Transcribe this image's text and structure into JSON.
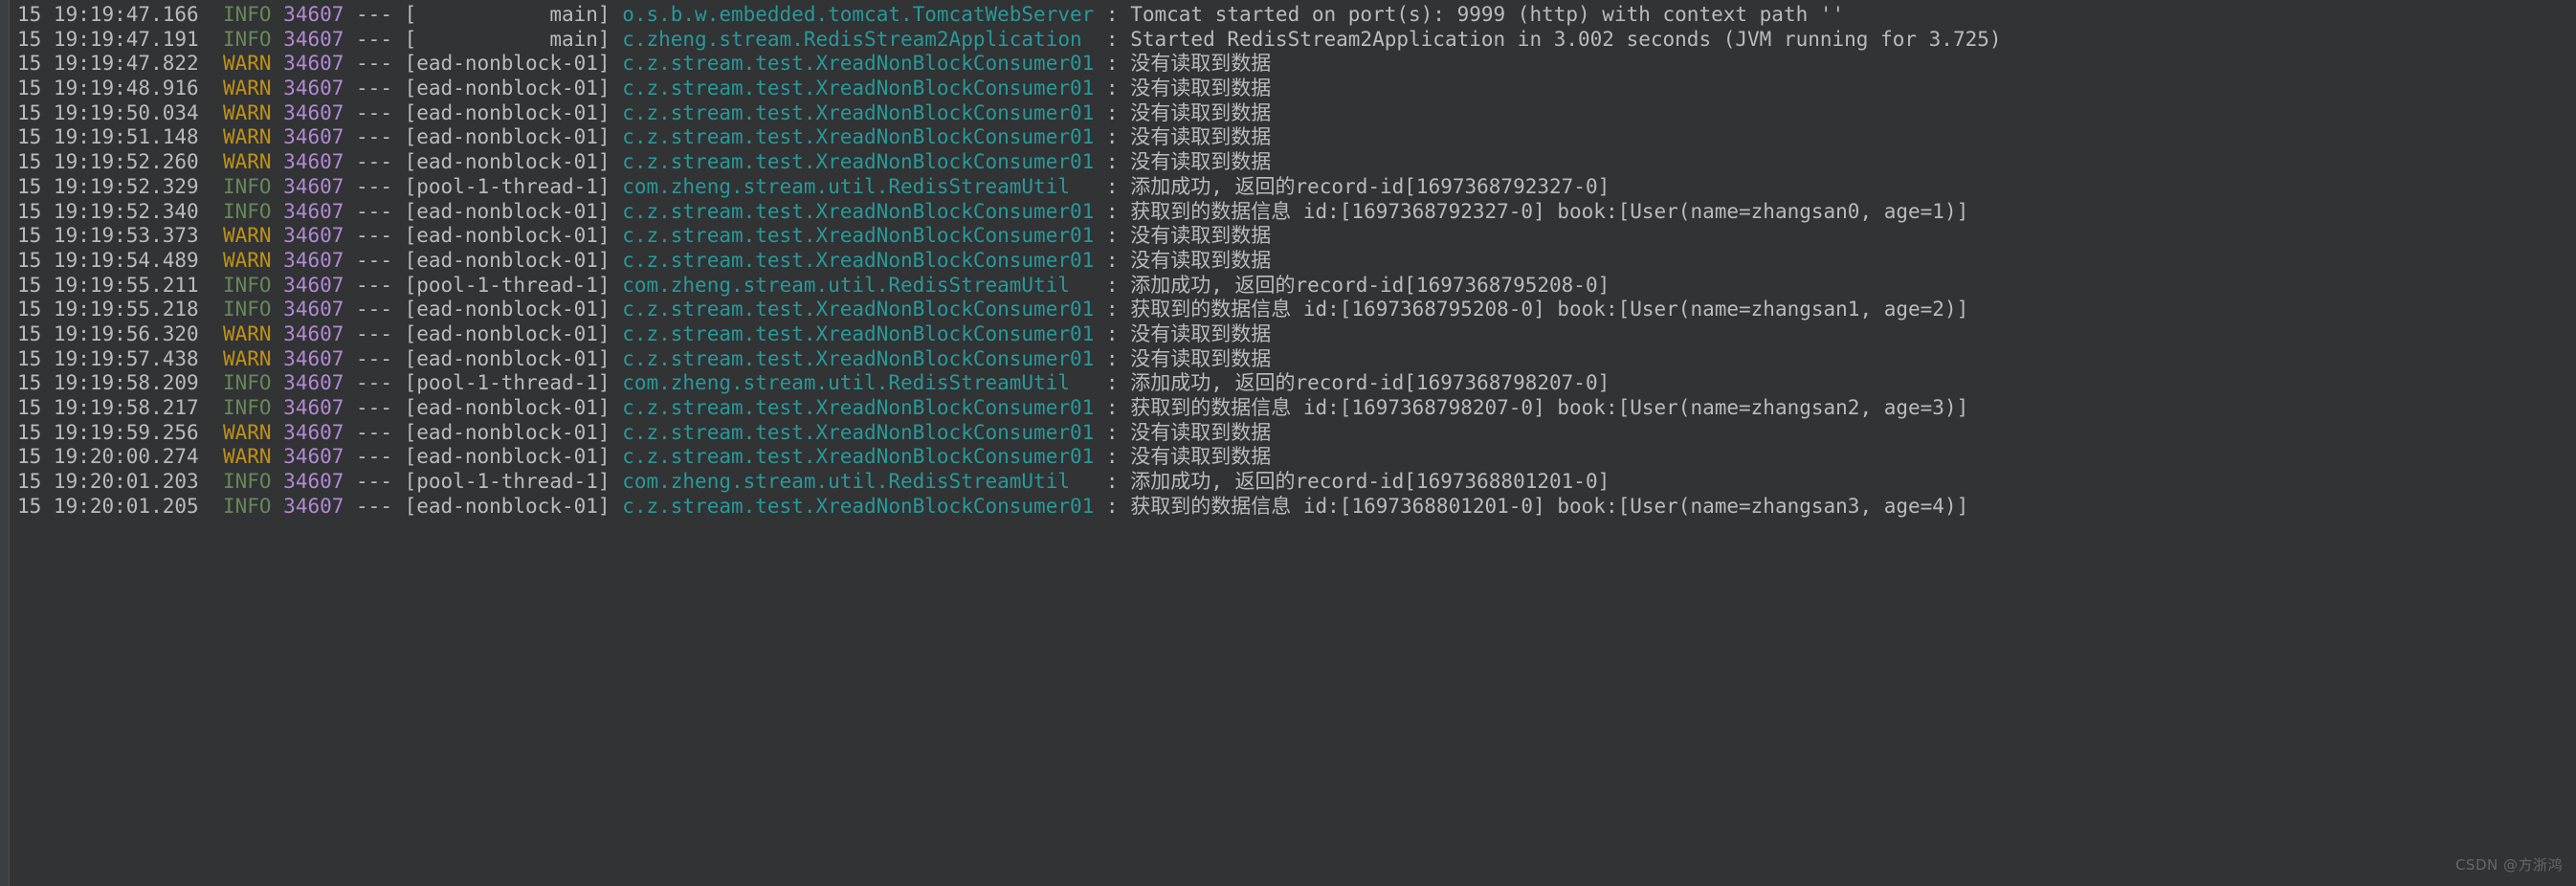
{
  "console": {
    "name": "spring-boot-console-log",
    "background_color": "#313335",
    "colors": {
      "plain": "#bbbbbb",
      "info": "#6a8759",
      "warn": "#bf9117",
      "pid": "#b389d4",
      "logger": "#299999",
      "message": "#bbbbbb"
    },
    "watermark": "CSDN @方浙鸿",
    "pid": "34607",
    "day": "15",
    "lines": [
      {
        "day": "15",
        "time": "19:19:47.166",
        "level": "INFO",
        "pid": "34607",
        "dashes": "---",
        "thread": "[           main]",
        "logger": "o.s.b.w.embedded.tomcat.TomcatWebServer",
        "sep": ":",
        "message": "Tomcat started on port(s): 9999 (http) with context path ''"
      },
      {
        "day": "15",
        "time": "19:19:47.191",
        "level": "INFO",
        "pid": "34607",
        "dashes": "---",
        "thread": "[           main]",
        "logger": "c.zheng.stream.RedisStream2Application",
        "sep": ":",
        "message": "Started RedisStream2Application in 3.002 seconds (JVM running for 3.725)"
      },
      {
        "day": "15",
        "time": "19:19:47.822",
        "level": "WARN",
        "pid": "34607",
        "dashes": "---",
        "thread": "[ead-nonblock-01]",
        "logger": "c.z.stream.test.XreadNonBlockConsumer01",
        "sep": ":",
        "message": "没有读取到数据"
      },
      {
        "day": "15",
        "time": "19:19:48.916",
        "level": "WARN",
        "pid": "34607",
        "dashes": "---",
        "thread": "[ead-nonblock-01]",
        "logger": "c.z.stream.test.XreadNonBlockConsumer01",
        "sep": ":",
        "message": "没有读取到数据"
      },
      {
        "day": "15",
        "time": "19:19:50.034",
        "level": "WARN",
        "pid": "34607",
        "dashes": "---",
        "thread": "[ead-nonblock-01]",
        "logger": "c.z.stream.test.XreadNonBlockConsumer01",
        "sep": ":",
        "message": "没有读取到数据"
      },
      {
        "day": "15",
        "time": "19:19:51.148",
        "level": "WARN",
        "pid": "34607",
        "dashes": "---",
        "thread": "[ead-nonblock-01]",
        "logger": "c.z.stream.test.XreadNonBlockConsumer01",
        "sep": ":",
        "message": "没有读取到数据"
      },
      {
        "day": "15",
        "time": "19:19:52.260",
        "level": "WARN",
        "pid": "34607",
        "dashes": "---",
        "thread": "[ead-nonblock-01]",
        "logger": "c.z.stream.test.XreadNonBlockConsumer01",
        "sep": ":",
        "message": "没有读取到数据"
      },
      {
        "day": "15",
        "time": "19:19:52.329",
        "level": "INFO",
        "pid": "34607",
        "dashes": "---",
        "thread": "[pool-1-thread-1]",
        "logger": "com.zheng.stream.util.RedisStreamUtil",
        "sep": ":",
        "message": "添加成功, 返回的record-id[1697368792327-0]"
      },
      {
        "day": "15",
        "time": "19:19:52.340",
        "level": "INFO",
        "pid": "34607",
        "dashes": "---",
        "thread": "[ead-nonblock-01]",
        "logger": "c.z.stream.test.XreadNonBlockConsumer01",
        "sep": ":",
        "message": "获取到的数据信息 id:[1697368792327-0] book:[User(name=zhangsan0, age=1)]"
      },
      {
        "day": "15",
        "time": "19:19:53.373",
        "level": "WARN",
        "pid": "34607",
        "dashes": "---",
        "thread": "[ead-nonblock-01]",
        "logger": "c.z.stream.test.XreadNonBlockConsumer01",
        "sep": ":",
        "message": "没有读取到数据"
      },
      {
        "day": "15",
        "time": "19:19:54.489",
        "level": "WARN",
        "pid": "34607",
        "dashes": "---",
        "thread": "[ead-nonblock-01]",
        "logger": "c.z.stream.test.XreadNonBlockConsumer01",
        "sep": ":",
        "message": "没有读取到数据"
      },
      {
        "day": "15",
        "time": "19:19:55.211",
        "level": "INFO",
        "pid": "34607",
        "dashes": "---",
        "thread": "[pool-1-thread-1]",
        "logger": "com.zheng.stream.util.RedisStreamUtil",
        "sep": ":",
        "message": "添加成功, 返回的record-id[1697368795208-0]"
      },
      {
        "day": "15",
        "time": "19:19:55.218",
        "level": "INFO",
        "pid": "34607",
        "dashes": "---",
        "thread": "[ead-nonblock-01]",
        "logger": "c.z.stream.test.XreadNonBlockConsumer01",
        "sep": ":",
        "message": "获取到的数据信息 id:[1697368795208-0] book:[User(name=zhangsan1, age=2)]"
      },
      {
        "day": "15",
        "time": "19:19:56.320",
        "level": "WARN",
        "pid": "34607",
        "dashes": "---",
        "thread": "[ead-nonblock-01]",
        "logger": "c.z.stream.test.XreadNonBlockConsumer01",
        "sep": ":",
        "message": "没有读取到数据"
      },
      {
        "day": "15",
        "time": "19:19:57.438",
        "level": "WARN",
        "pid": "34607",
        "dashes": "---",
        "thread": "[ead-nonblock-01]",
        "logger": "c.z.stream.test.XreadNonBlockConsumer01",
        "sep": ":",
        "message": "没有读取到数据"
      },
      {
        "day": "15",
        "time": "19:19:58.209",
        "level": "INFO",
        "pid": "34607",
        "dashes": "---",
        "thread": "[pool-1-thread-1]",
        "logger": "com.zheng.stream.util.RedisStreamUtil",
        "sep": ":",
        "message": "添加成功, 返回的record-id[1697368798207-0]"
      },
      {
        "day": "15",
        "time": "19:19:58.217",
        "level": "INFO",
        "pid": "34607",
        "dashes": "---",
        "thread": "[ead-nonblock-01]",
        "logger": "c.z.stream.test.XreadNonBlockConsumer01",
        "sep": ":",
        "message": "获取到的数据信息 id:[1697368798207-0] book:[User(name=zhangsan2, age=3)]"
      },
      {
        "day": "15",
        "time": "19:19:59.256",
        "level": "WARN",
        "pid": "34607",
        "dashes": "---",
        "thread": "[ead-nonblock-01]",
        "logger": "c.z.stream.test.XreadNonBlockConsumer01",
        "sep": ":",
        "message": "没有读取到数据"
      },
      {
        "day": "15",
        "time": "19:20:00.274",
        "level": "WARN",
        "pid": "34607",
        "dashes": "---",
        "thread": "[ead-nonblock-01]",
        "logger": "c.z.stream.test.XreadNonBlockConsumer01",
        "sep": ":",
        "message": "没有读取到数据"
      },
      {
        "day": "15",
        "time": "19:20:01.203",
        "level": "INFO",
        "pid": "34607",
        "dashes": "---",
        "thread": "[pool-1-thread-1]",
        "logger": "com.zheng.stream.util.RedisStreamUtil",
        "sep": ":",
        "message": "添加成功, 返回的record-id[1697368801201-0]"
      },
      {
        "day": "15",
        "time": "19:20:01.205",
        "level": "INFO",
        "pid": "34607",
        "dashes": "---",
        "thread": "[ead-nonblock-01]",
        "logger": "c.z.stream.test.XreadNonBlockConsumer01",
        "sep": ":",
        "message": "获取到的数据信息 id:[1697368801201-0] book:[User(name=zhangsan3, age=4)]"
      }
    ]
  }
}
